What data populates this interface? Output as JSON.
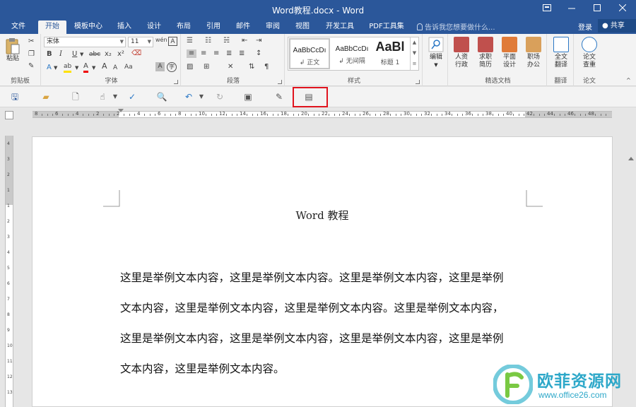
{
  "window": {
    "title": "Word教程.docx - Word",
    "buttons": [
      "restore-ribbon",
      "minimize",
      "maximize",
      "close"
    ]
  },
  "tabs": [
    "文件",
    "开始",
    "模板中心",
    "插入",
    "设计",
    "布局",
    "引用",
    "邮件",
    "审阅",
    "视图",
    "开发工具",
    "PDF工具集"
  ],
  "active_tab": "开始",
  "tell_me": "告诉我您想要做什么...",
  "sign_in": "登录",
  "share": "共享",
  "ribbon": {
    "clipboard": {
      "paste": "粘贴",
      "label": "剪贴板"
    },
    "font": {
      "name": "宋体",
      "size": "11",
      "label": "字体",
      "bold": "B",
      "italic": "I",
      "underline": "U",
      "strike": "abc",
      "subscript": "x₂",
      "superscript": "x²",
      "font_color_glyph": "A",
      "highlight_glyph": "ab",
      "grow": "A",
      "shrink": "A",
      "aa": "Aa",
      "wen": "wén",
      "clear": "A",
      "char_border": "A",
      "char_shading": "A",
      "enclose": "字"
    },
    "paragraph": {
      "label": "段落"
    },
    "styles": {
      "label": "样式",
      "items": [
        {
          "sample": "AaBbCcDı",
          "name": "↲ 正文"
        },
        {
          "sample": "AaBbCcDı",
          "name": "↲ 无间隔"
        },
        {
          "sample": "AaBl",
          "name": "标题 1"
        }
      ]
    },
    "editing": {
      "label": "编辑"
    },
    "templates": {
      "label": "精选文档",
      "items": [
        "人资\n行政",
        "求职\n简历",
        "平面\n设计",
        "职场\n办公"
      ]
    },
    "translate": {
      "btn": "全文\n翻译",
      "label": "翻译"
    },
    "paper": {
      "btn": "论文\n查重",
      "label": "论文"
    }
  },
  "ruler": {
    "numbers": [
      "8",
      "6",
      "4",
      "2",
      "2",
      "4",
      "6",
      "8",
      "10",
      "12",
      "14",
      "16",
      "18",
      "20",
      "22",
      "24",
      "26",
      "28",
      "30",
      "32",
      "34",
      "36",
      "38",
      "40",
      "42",
      "44",
      "46",
      "48"
    ],
    "vnumbers": [
      "4",
      "3",
      "2",
      "1",
      "1",
      "2",
      "3",
      "4",
      "5",
      "6",
      "7",
      "8",
      "9",
      "10",
      "11",
      "12",
      "13"
    ]
  },
  "document": {
    "title": "Word 教程",
    "lines": [
      "这里是举例文本内容，这里是举例文本内容。这里是举例文本内容，这里是举例",
      "文本内容，这里是举例文本内容，这里是举例文本内容。这里是举例文本内容，",
      "这里是举例文本内容，这里是举例文本内容，这里是举例文本内容，这里是举例",
      "文本内容，这里是举例文本内容。"
    ]
  },
  "watermark": {
    "brand": "欧菲资源网",
    "url": "www.office26.com"
  },
  "colors": {
    "titlebar": "#2b579a",
    "highlight": "#e0141e",
    "watermark": "#2ea8c9"
  }
}
